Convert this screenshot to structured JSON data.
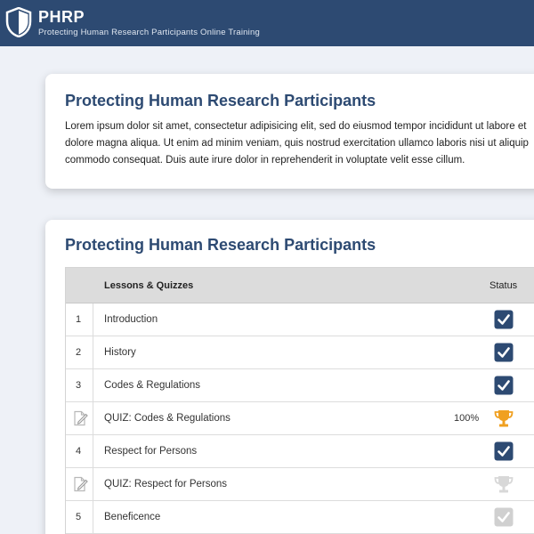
{
  "header": {
    "brand": "PHRP",
    "subtitle": "Protecting Human Research Participants Online Training"
  },
  "intro_card": {
    "title": "Protecting Human Research Participants",
    "lines": [
      "Lorem ipsum dolor sit amet, consectetur adipisicing elit, sed do eiusmod tempor incididunt ut labore et",
      "dolore magna aliqua. Ut enim ad minim veniam, quis nostrud exercitation ullamco laboris nisi ut aliquip",
      "commodo consequat. Duis aute irure dolor in reprehenderit in voluptate velit esse cillum."
    ]
  },
  "lessons_card": {
    "title": "Protecting Human Research Participants",
    "columns": {
      "lessons": "Lessons & Quizzes",
      "status": "Status"
    },
    "rows": [
      {
        "num": "1",
        "label": "Introduction",
        "kind": "lesson",
        "status": "complete"
      },
      {
        "num": "2",
        "label": "History",
        "kind": "lesson",
        "status": "complete"
      },
      {
        "num": "3",
        "label": "Codes & Regulations",
        "kind": "lesson",
        "status": "complete"
      },
      {
        "num": "",
        "label": "QUIZ: Codes & Regulations",
        "kind": "quiz",
        "score": "100%",
        "status": "passed"
      },
      {
        "num": "4",
        "label": "Respect for Persons",
        "kind": "lesson",
        "status": "complete"
      },
      {
        "num": "",
        "label": "QUIZ: Respect for Persons",
        "kind": "quiz",
        "status": "locked"
      },
      {
        "num": "5",
        "label": "Beneficence",
        "kind": "lesson",
        "status": "incomplete"
      }
    ]
  },
  "colors": {
    "brand": "#2d4a72",
    "check": "#2d4a72",
    "check_disabled": "#d0d0d0",
    "trophy": "#f0a020",
    "trophy_disabled": "#d8d8d8"
  },
  "icons": {
    "logo": "shield-icon",
    "complete": "checkbox-checked-icon",
    "passed": "trophy-icon",
    "locked": "trophy-outline-icon",
    "incomplete": "checkbox-disabled-icon",
    "quiz": "quiz-edit-icon"
  }
}
